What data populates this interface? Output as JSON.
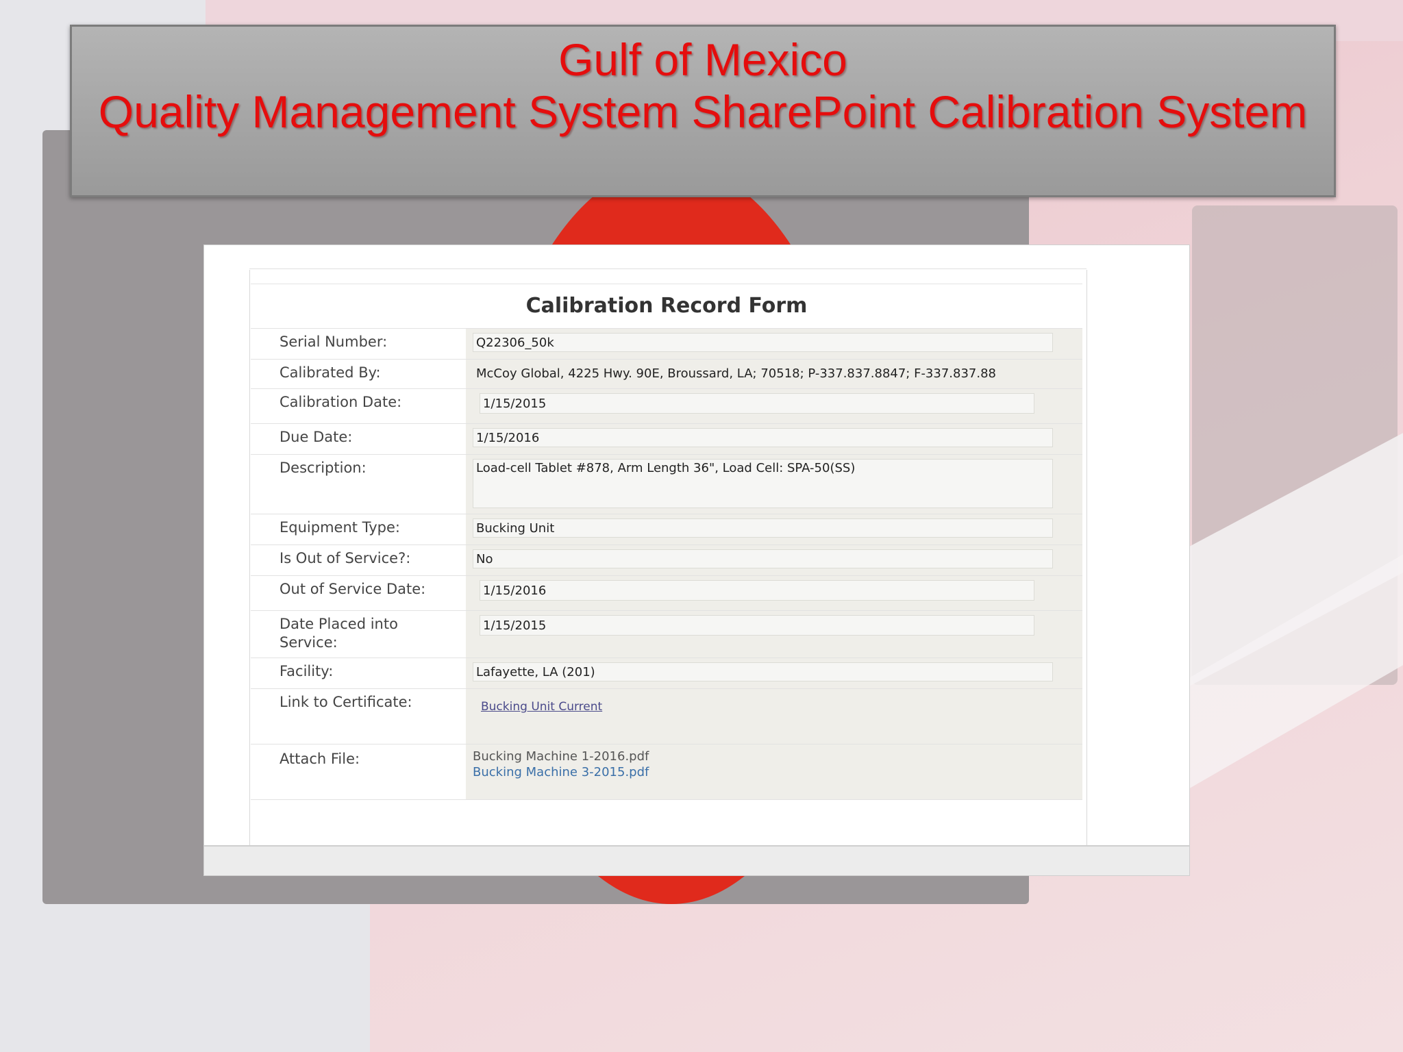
{
  "slide": {
    "title_line1": "Gulf of Mexico",
    "title_line2": "Quality Management System SharePoint Calibration System",
    "title_color": "#e50d0d"
  },
  "form": {
    "title": "Calibration Record Form",
    "fields": {
      "serial_number": {
        "label": "Serial Number:",
        "value": "Q22306_50k"
      },
      "calibrated_by": {
        "label": "Calibrated By:",
        "value": "McCoy Global, 4225 Hwy. 90E, Broussard, LA; 70518; P-337.837.8847; F-337.837.88"
      },
      "calibration_date": {
        "label": "Calibration Date:",
        "value": "1/15/2015"
      },
      "due_date": {
        "label": "Due Date:",
        "value": "1/15/2016"
      },
      "description": {
        "label": "Description:",
        "value": "Load-cell Tablet #878, Arm Length 36\", Load Cell: SPA-50(SS)"
      },
      "equipment_type": {
        "label": "Equipment Type:",
        "value": "Bucking Unit"
      },
      "is_out_of_service": {
        "label": "Is Out of Service?:",
        "value": "No"
      },
      "out_of_service_date": {
        "label": "Out of Service Date:",
        "value": "1/15/2016"
      },
      "date_placed_into_service": {
        "label": "Date Placed into Service:",
        "value": "1/15/2015"
      },
      "facility": {
        "label": "Facility:",
        "value": "Lafayette, LA (201)"
      },
      "link_to_certificate": {
        "label": "Link to Certificate:",
        "value": "Bucking Unit Current"
      },
      "attach_file": {
        "label": "Attach File:",
        "files": [
          "Bucking Machine 1-2016.pdf",
          "Bucking Machine 3-2015.pdf"
        ]
      }
    }
  }
}
